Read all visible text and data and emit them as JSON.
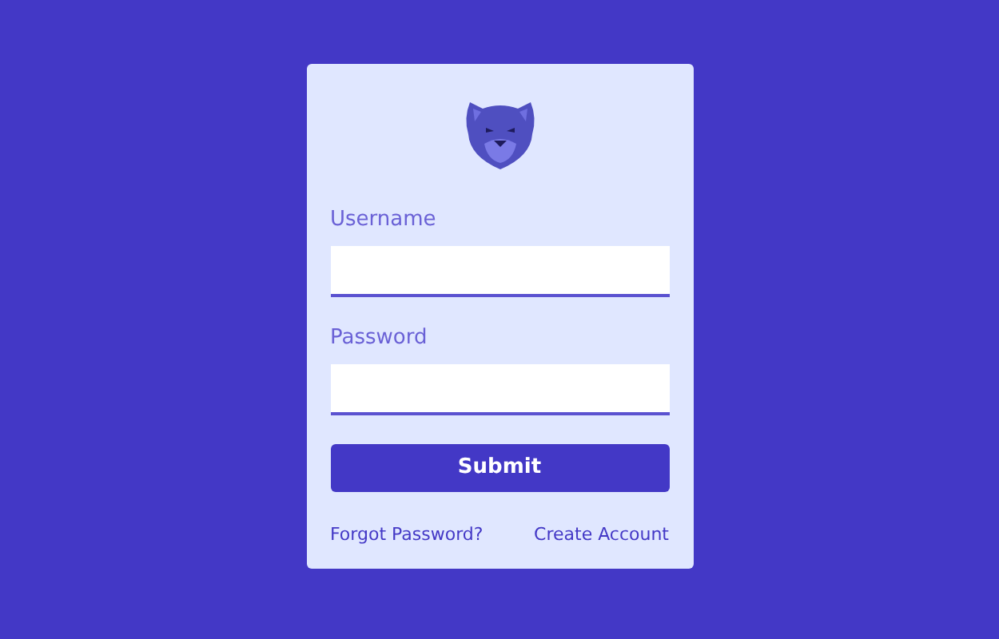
{
  "form": {
    "fields": [
      {
        "label": "Username"
      },
      {
        "label": "Password"
      }
    ],
    "submit": "Submit",
    "links": [
      "Forgot Password?",
      "Create Account"
    ]
  }
}
